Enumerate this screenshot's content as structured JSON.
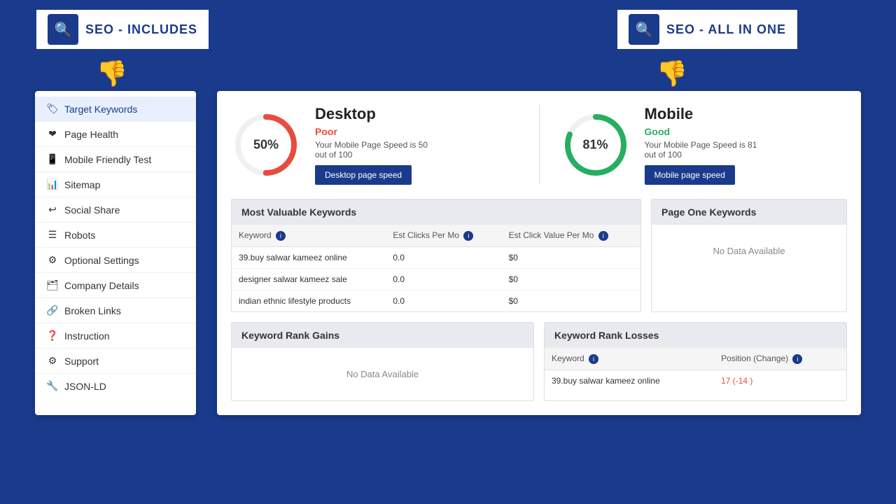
{
  "logos": {
    "left": {
      "text": "SEO - INCLUDES",
      "icon": "🔍"
    },
    "right": {
      "text": "SEO - ALL IN ONE",
      "icon": "🔍"
    }
  },
  "sidebar": {
    "items": [
      {
        "id": "target-keywords",
        "label": "Target Keywords",
        "icon": "🏷",
        "active": true
      },
      {
        "id": "page-health",
        "label": "Page Health",
        "icon": "❤",
        "active": false
      },
      {
        "id": "mobile-friendly",
        "label": "Mobile Friendly Test",
        "icon": "📱",
        "active": false
      },
      {
        "id": "sitemap",
        "label": "Sitemap",
        "icon": "📊",
        "active": false
      },
      {
        "id": "social-share",
        "label": "Social Share",
        "icon": "↩",
        "active": false
      },
      {
        "id": "robots",
        "label": "Robots",
        "icon": "☰",
        "active": false
      },
      {
        "id": "optional-settings",
        "label": "Optional Settings",
        "icon": "⚙",
        "active": false
      },
      {
        "id": "company-details",
        "label": "Company Details",
        "icon": "🗂",
        "active": false
      },
      {
        "id": "broken-links",
        "label": "Broken Links",
        "icon": "🔗",
        "active": false
      },
      {
        "id": "instruction",
        "label": "Instruction",
        "icon": "❓",
        "active": false
      },
      {
        "id": "support",
        "label": "Support",
        "icon": "⚙",
        "active": false
      },
      {
        "id": "json-ld",
        "label": "JSON-LD",
        "icon": "🔧",
        "active": false
      }
    ]
  },
  "desktop": {
    "title": "Desktop",
    "percent": "50%",
    "status": "Poor",
    "description": "Your Mobile Page Speed is 50 out of 100",
    "button": "Desktop page speed",
    "value": 50,
    "color": "#e74c3c"
  },
  "mobile": {
    "title": "Mobile",
    "percent": "81%",
    "status": "Good",
    "description": "Your Mobile Page Speed is 81 out of 100",
    "button": "Mobile page speed",
    "value": 81,
    "color": "#27ae60"
  },
  "most_valuable_keywords": {
    "title": "Most Valuable Keywords",
    "columns": [
      "Keyword",
      "Est Clicks Per Mo",
      "Est Click Value Per Mo"
    ],
    "rows": [
      {
        "keyword": "39.buy salwar kameez online",
        "clicks": "0.0",
        "value": "$0"
      },
      {
        "keyword": "designer salwar kameez sale",
        "clicks": "0.0",
        "value": "$0"
      },
      {
        "keyword": "indian ethnic lifestyle products",
        "clicks": "0.0",
        "value": "$0"
      }
    ]
  },
  "page_one_keywords": {
    "title": "Page One Keywords",
    "no_data": "No Data Available"
  },
  "keyword_rank_gains": {
    "title": "Keyword Rank Gains",
    "no_data": "No Data Available"
  },
  "keyword_rank_losses": {
    "title": "Keyword Rank Losses",
    "columns": [
      "Keyword",
      "Position (Change)"
    ],
    "rows": [
      {
        "keyword": "39.buy salwar kameez online",
        "position": "17 (-14  )"
      }
    ]
  }
}
